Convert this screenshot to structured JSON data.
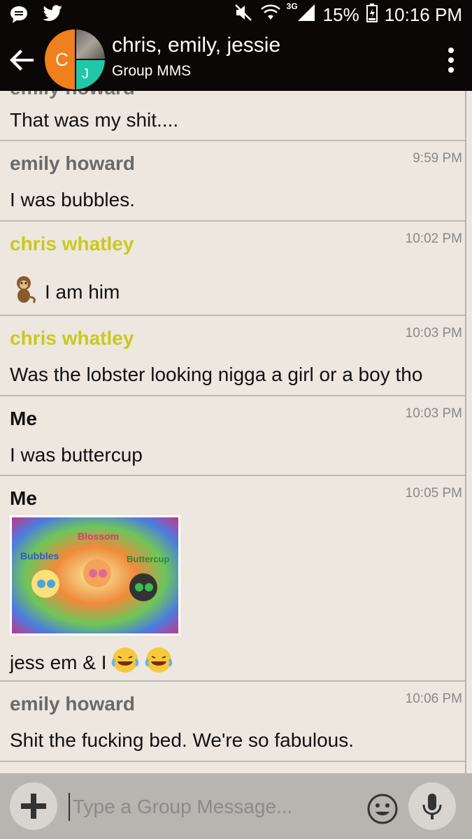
{
  "status_bar": {
    "battery": "15%",
    "time": "10:16 PM",
    "network": "3G"
  },
  "header": {
    "title": "chris, emily, jessie",
    "subtitle": "Group MMS",
    "avatar_initials": {
      "c": "C",
      "j": "J"
    }
  },
  "thread": {
    "partial_top": {
      "sender": "emily howard",
      "text": "That was my shit...."
    },
    "messages": [
      {
        "sender": "emily howard",
        "time": "9:59 PM",
        "text": "I was bubbles."
      },
      {
        "sender": "chris whatley",
        "time": "10:02 PM",
        "text": "I am him"
      },
      {
        "sender": "chris whatley",
        "time": "10:03 PM",
        "text": "Was the lobster looking nigga a girl or a boy tho"
      },
      {
        "sender": "Me",
        "time": "10:03 PM",
        "text": "I was buttercup"
      },
      {
        "sender": "Me",
        "time": "10:05 PM",
        "text": "jess em & I",
        "image_labels": [
          "Bubbles",
          "Blossom",
          "Buttercup"
        ]
      },
      {
        "sender": "emily howard",
        "time": "10:06 PM",
        "text": "Shit the fucking bed. We're so fabulous."
      }
    ]
  },
  "composer": {
    "placeholder": "Type a Group Message..."
  },
  "colors": {
    "appbar": "#0b0706",
    "background": "#ede7df",
    "chris_name": "#c9c91e",
    "avatar_c": "#f07f1d",
    "avatar_j": "#22c7a8"
  },
  "icons": [
    "chat-icon",
    "twitter-icon",
    "mute-icon",
    "wifi-icon",
    "signal-icon",
    "battery-icon",
    "back-arrow-icon",
    "overflow-menu-icon",
    "plus-icon",
    "emoji-icon",
    "mic-icon",
    "monkey-emoji",
    "laughing-emoji"
  ]
}
